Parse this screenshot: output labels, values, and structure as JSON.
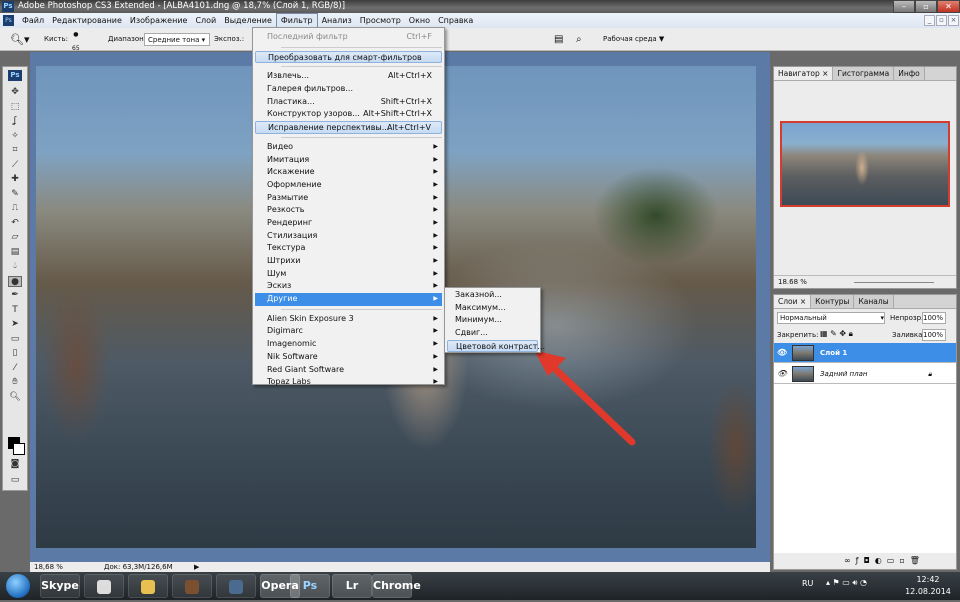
{
  "window": {
    "title": "Adobe Photoshop CS3 Extended - [ALBA4101.dng @ 18,7% (Слой 1, RGB/8)]",
    "app_icon": "Ps"
  },
  "menubar": [
    "Файл",
    "Редактирование",
    "Изображение",
    "Слой",
    "Выделение",
    "Фильтр",
    "Анализ",
    "Просмотр",
    "Окно",
    "Справка"
  ],
  "options": {
    "brush_label": "Кисть:",
    "brush_size": "65",
    "range_label": "Диапазон:",
    "range_value": "Средние тона",
    "exposure_label": "Экспоз.:",
    "workspace_label": "Рабочая среда ▼"
  },
  "filter_menu": {
    "last": {
      "label": "Последний фильтр",
      "shortcut": "Ctrl+F"
    },
    "smart": {
      "label": "Преобразовать для смарт-фильтров"
    },
    "group1": [
      {
        "label": "Извлечь...",
        "shortcut": "Alt+Ctrl+X"
      },
      {
        "label": "Галерея фильтров...",
        "shortcut": ""
      },
      {
        "label": "Пластика...",
        "shortcut": "Shift+Ctrl+X"
      },
      {
        "label": "Конструктор узоров...",
        "shortcut": "Alt+Shift+Ctrl+X"
      },
      {
        "label": "Исправление перспективы...",
        "shortcut": "Alt+Ctrl+V"
      }
    ],
    "group2": [
      "Видео",
      "Имитация",
      "Искажение",
      "Оформление",
      "Размытие",
      "Резкость",
      "Рендеринг",
      "Стилизация",
      "Текстура",
      "Штрихи",
      "Шум",
      "Эскиз",
      "Другие"
    ],
    "group3": [
      "Alien Skin Exposure 3",
      "Digimarc",
      "Imagenomic",
      "Nik Software",
      "Red Giant Software",
      "Topaz Labs"
    ]
  },
  "submenu": [
    "Заказной...",
    "Максимум...",
    "Минимум...",
    "Сдвиг...",
    "Цветовой контраст..."
  ],
  "status": {
    "zoom": "18,68 %",
    "doc": "Док: 63,3M/126,6M"
  },
  "navigator": {
    "tabs": [
      "Навигатор ×",
      "Гистограмма",
      "Инфо"
    ],
    "zoom": "18.68 %"
  },
  "layers": {
    "tabs": [
      "Слои ×",
      "Контуры",
      "Каналы"
    ],
    "blend_mode": "Нормальный",
    "opacity_label": "Непрозр.:",
    "opacity": "100%",
    "lock_label": "Закрепить:",
    "fill_label": "Заливка:",
    "fill": "100%",
    "items": [
      "Слой 1",
      "Задний план"
    ]
  },
  "taskbar": {
    "lang": "RU",
    "time": "12:42",
    "date": "12.08.2014",
    "apps": [
      "Skype",
      "",
      "",
      "",
      "",
      "Opera",
      "Ps",
      "Lr",
      "Chrome"
    ]
  },
  "colors": {
    "accent": "#3d8ee6",
    "arrow": "#e0392b"
  }
}
